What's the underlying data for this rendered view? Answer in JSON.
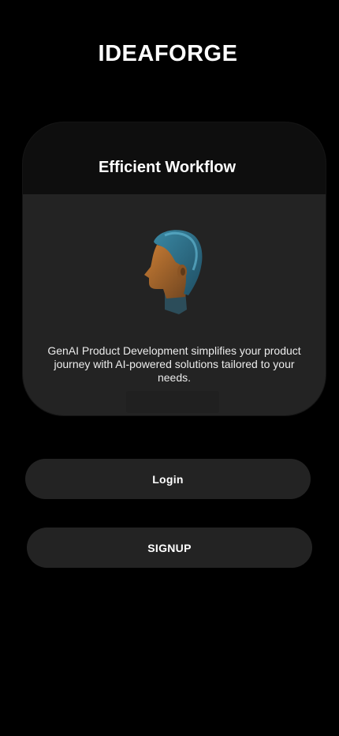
{
  "app": {
    "title": "IDEAFORGE"
  },
  "card": {
    "title": "Efficient Workflow",
    "description": "GenAI Product Development simplifies your product journey with AI-powered solutions tailored to your needs.",
    "illustration_icon": "ai-head-profile-icon"
  },
  "actions": {
    "login_label": "Login",
    "signup_label": "SIGNUP"
  },
  "colors": {
    "background": "#000000",
    "card": "#232323",
    "card_header": "#0e0e0e",
    "button": "#232323",
    "text": "#ffffff",
    "head_hair": "#2f6f86",
    "head_skin": "#b96f2a"
  }
}
